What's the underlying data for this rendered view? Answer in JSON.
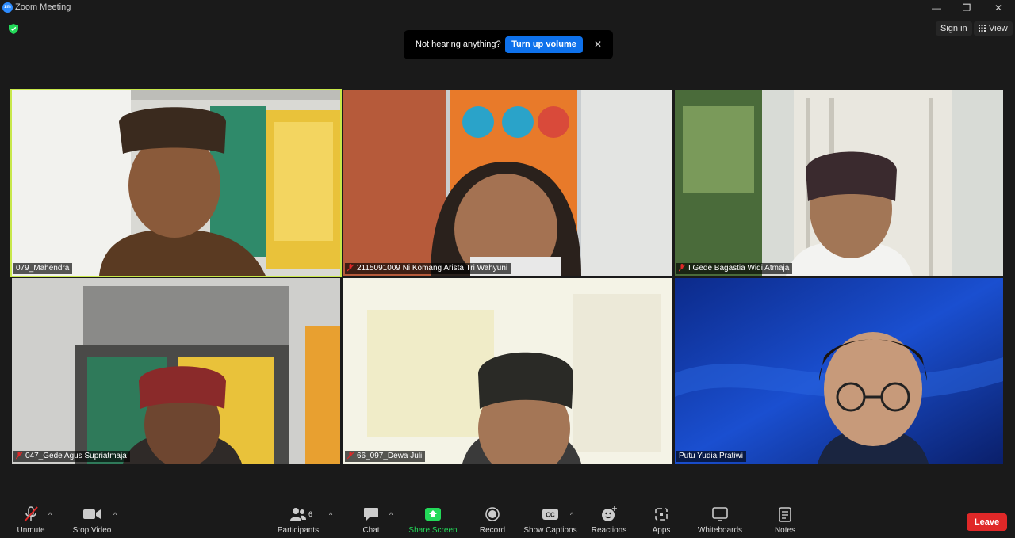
{
  "window": {
    "title": "Zoom Meeting",
    "logo_text": "zm",
    "minimize": "—",
    "restore": "❐",
    "close": "✕"
  },
  "top_right": {
    "sign_in": "Sign in",
    "view": "View"
  },
  "notification": {
    "text": "Not hearing anything?",
    "button": "Turn up volume",
    "close": "✕"
  },
  "participants": [
    {
      "name": "079_Mahendra",
      "muted": false,
      "active": true
    },
    {
      "name": "2115091009 Ni Komang Arista Tri Wahyuni",
      "muted": true,
      "active": false
    },
    {
      "name": "I Gede Bagastia Widi Atmaja",
      "muted": true,
      "active": false
    },
    {
      "name": "047_Gede Agus Supriatmaja",
      "muted": true,
      "active": false
    },
    {
      "name": "66_097_Dewa Juli",
      "muted": true,
      "active": false
    },
    {
      "name": "Putu Yudia Pratiwi",
      "muted": false,
      "active": false
    }
  ],
  "toolbar": {
    "unmute": "Unmute",
    "stop_video": "Stop Video",
    "participants": "Participants",
    "participants_count": "6",
    "chat": "Chat",
    "share_screen": "Share Screen",
    "record": "Record",
    "show_captions": "Show Captions",
    "captions_badge": "CC",
    "reactions": "Reactions",
    "apps": "Apps",
    "whiteboards": "Whiteboards",
    "notes": "Notes",
    "leave": "Leave"
  },
  "colors": {
    "background": "#1a1a1a",
    "accent_blue": "#0e71eb",
    "active_speaker": "#c8e84a",
    "share_green": "#23d959",
    "leave_red": "#e02828",
    "muted_red": "#e02828"
  }
}
